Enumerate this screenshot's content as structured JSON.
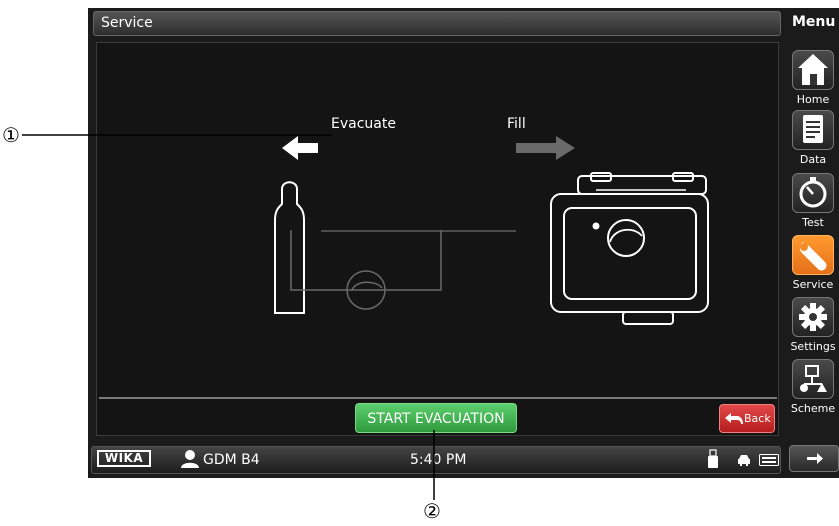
{
  "header": {
    "title": "Service"
  },
  "menu": {
    "title": "Menu",
    "items": [
      {
        "label": "Home",
        "icon": "home-icon"
      },
      {
        "label": "Data",
        "icon": "notepad-icon"
      },
      {
        "label": "Test",
        "icon": "gauge-icon"
      },
      {
        "label": "Service",
        "icon": "wrench-icon",
        "active": true
      },
      {
        "label": "Settings",
        "icon": "gear-icon"
      },
      {
        "label": "Scheme",
        "icon": "scheme-icon"
      }
    ],
    "next_icon": "arrow-right-icon"
  },
  "diagram": {
    "evacuate_label": "Evacuate",
    "fill_label": "Fill"
  },
  "actions": {
    "start_label": "START EVACUATION",
    "back_label": "Back"
  },
  "status": {
    "brand": "WIKA",
    "user": "GDM B4",
    "time": "5:40 PM"
  },
  "callouts": {
    "one": "①",
    "two": "②"
  },
  "colors": {
    "accent_orange": "#f28a26",
    "start_green": "#3cb44b",
    "back_red": "#d32f2f"
  }
}
